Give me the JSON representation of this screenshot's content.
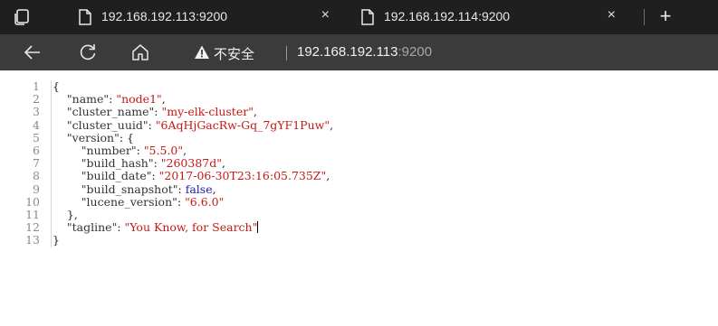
{
  "browser": {
    "tabs": [
      {
        "title": "192.168.192.113:9200",
        "active": true
      },
      {
        "title": "192.168.192.114:9200",
        "active": false
      }
    ],
    "close_glyph": "×",
    "new_tab_glyph": "+",
    "security_label": "不安全",
    "url_host": "192.168.192.113",
    "url_port": ":9200",
    "colors": {
      "tabbar_bg": "#1f1f1f",
      "toolbar_bg": "#3b3b3b",
      "string": "#c41a16",
      "keyword": "#1a1aa6"
    }
  },
  "json_view": {
    "line_numbers": [
      "1",
      "2",
      "3",
      "4",
      "5",
      "6",
      "7",
      "8",
      "9",
      "10",
      "11",
      "12",
      "13"
    ],
    "lines": [
      {
        "indent": "",
        "parts": [
          [
            "punc",
            "{"
          ]
        ]
      },
      {
        "indent": "    ",
        "parts": [
          [
            "key",
            "\"name\""
          ],
          [
            "punc",
            ": "
          ],
          [
            "str",
            "\"node1\""
          ],
          [
            "punc",
            ","
          ]
        ]
      },
      {
        "indent": "    ",
        "parts": [
          [
            "key",
            "\"cluster_name\""
          ],
          [
            "punc",
            ": "
          ],
          [
            "str",
            "\"my-elk-cluster\""
          ],
          [
            "punc",
            ","
          ]
        ]
      },
      {
        "indent": "    ",
        "parts": [
          [
            "key",
            "\"cluster_uuid\""
          ],
          [
            "punc",
            ": "
          ],
          [
            "str",
            "\"6AqHjGacRw-Gq_7gYF1Puw\""
          ],
          [
            "punc",
            ","
          ]
        ]
      },
      {
        "indent": "    ",
        "parts": [
          [
            "key",
            "\"version\""
          ],
          [
            "punc",
            ": {"
          ]
        ]
      },
      {
        "indent": "        ",
        "parts": [
          [
            "key",
            "\"number\""
          ],
          [
            "punc",
            ": "
          ],
          [
            "str",
            "\"5.5.0\""
          ],
          [
            "punc",
            ","
          ]
        ]
      },
      {
        "indent": "        ",
        "parts": [
          [
            "key",
            "\"build_hash\""
          ],
          [
            "punc",
            ": "
          ],
          [
            "str",
            "\"260387d\""
          ],
          [
            "punc",
            ","
          ]
        ]
      },
      {
        "indent": "        ",
        "parts": [
          [
            "key",
            "\"build_date\""
          ],
          [
            "punc",
            ": "
          ],
          [
            "str",
            "\"2017-06-30T23:16:05.735Z\""
          ],
          [
            "punc",
            ","
          ]
        ]
      },
      {
        "indent": "        ",
        "parts": [
          [
            "key",
            "\"build_snapshot\""
          ],
          [
            "punc",
            ": "
          ],
          [
            "kw",
            "false"
          ],
          [
            "punc",
            ","
          ]
        ]
      },
      {
        "indent": "        ",
        "parts": [
          [
            "key",
            "\"lucene_version\""
          ],
          [
            "punc",
            ": "
          ],
          [
            "str",
            "\"6.6.0\""
          ]
        ]
      },
      {
        "indent": "    ",
        "parts": [
          [
            "punc",
            "},"
          ]
        ]
      },
      {
        "indent": "    ",
        "parts": [
          [
            "key",
            "\"tagline\""
          ],
          [
            "punc",
            ": "
          ],
          [
            "str",
            "\"You Know, for Search\""
          ]
        ],
        "caret": true
      },
      {
        "indent": "",
        "parts": [
          [
            "punc",
            "}"
          ]
        ]
      }
    ]
  }
}
